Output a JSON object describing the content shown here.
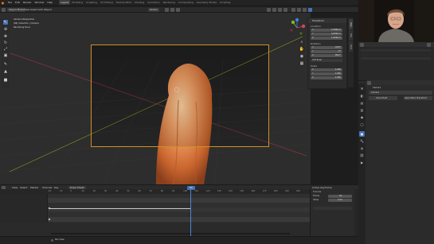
{
  "topbar": {
    "menus": [
      "File",
      "Edit",
      "Render",
      "Window",
      "Help"
    ],
    "workspaces": [
      "Layout",
      "Modeling",
      "Sculpting",
      "UV Editing",
      "Texture Paint",
      "Shading",
      "Animation",
      "Rendering",
      "Compositing",
      "Geometry Nodes",
      "Scripting"
    ],
    "active_workspace": "Layout"
  },
  "viewport_header": {
    "mode": "Object Mode",
    "menus": [
      "View",
      "Select",
      "Add",
      "Object"
    ],
    "orientation": "Global"
  },
  "viewport_info": {
    "line1": "Camera Perspective",
    "line2": "(84) Collection | Camera",
    "line3": "Rendering Done"
  },
  "npanel": {
    "title": "Transform",
    "location_label": "Location",
    "location": [
      {
        "axis": "X",
        "value": "2.5695 m"
      },
      {
        "axis": "Y",
        "value": "0.6593 m"
      },
      {
        "axis": "Z",
        "value": "1.8316 m"
      }
    ],
    "rotation_label": "Rotation",
    "rotation": [
      {
        "axis": "X",
        "value": "9.53°"
      },
      {
        "axis": "Y",
        "value": "0°"
      },
      {
        "axis": "Z",
        "value": "89.2°"
      }
    ],
    "rotation_mode": "XYZ Euler",
    "scale_label": "Scale",
    "scale": [
      {
        "axis": "X",
        "value": "1.000"
      },
      {
        "axis": "Y",
        "value": "1.000"
      },
      {
        "axis": "Z",
        "value": "1.000"
      }
    ],
    "tabs": [
      "Item",
      "Tool",
      "View"
    ]
  },
  "properties": {
    "header": "Camera",
    "object_name": "Camera",
    "btn1": "Cloud Field",
    "btn2": "Align Mean Transform"
  },
  "timeline": {
    "menus": [
      "View",
      "Select",
      "Marker",
      "Channel",
      "Key"
    ],
    "mode": "Dope Sheet",
    "current_frame": "84",
    "ticks": [
      "-20",
      "-10",
      "0",
      "10",
      "20",
      "30",
      "40",
      "50",
      "60",
      "70",
      "80",
      "90",
      "100",
      "110",
      "120",
      "130",
      "140",
      "150",
      "160",
      "170",
      "180",
      "190",
      "200"
    ],
    "panel_title": "Active Keyframe",
    "fcurve_title": "F-Curve",
    "fc_field1_label": "Frame",
    "fc_field1_value": "84",
    "fc_field2_label": "Value",
    "fc_field2_value": "0.00",
    "footer": "Pan View"
  },
  "colors": {
    "accent": "#4772b3",
    "camera_frame": "#cf9020",
    "playhead": "#4d86d6",
    "keyframe": "#c9c9c9"
  }
}
